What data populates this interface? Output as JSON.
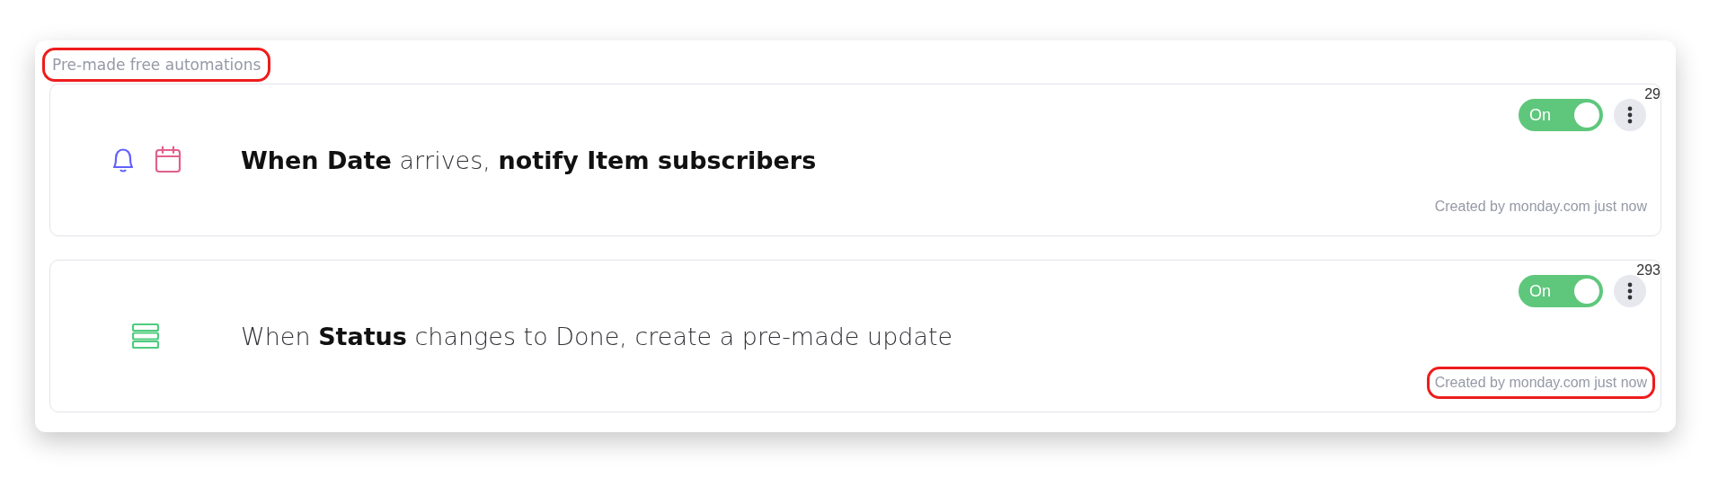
{
  "section": {
    "title": "Pre-made free automations",
    "title_highlighted": true
  },
  "automations": [
    {
      "icons": [
        {
          "kind": "bell"
        },
        {
          "kind": "calendar"
        }
      ],
      "sentence": "**When Date** arrives, **notify Item subscribers**",
      "toggle": {
        "label": "On",
        "on": true
      },
      "count": "29",
      "footer": "Created by monday.com just now",
      "footer_highlighted": false
    },
    {
      "icons": [
        {
          "kind": "rows"
        }
      ],
      "sentence": "When **Status** changes to Done, create a pre-made update",
      "toggle": {
        "label": "On",
        "on": true
      },
      "count": "293",
      "footer": "Created by monday.com just now",
      "footer_highlighted": true
    }
  ]
}
